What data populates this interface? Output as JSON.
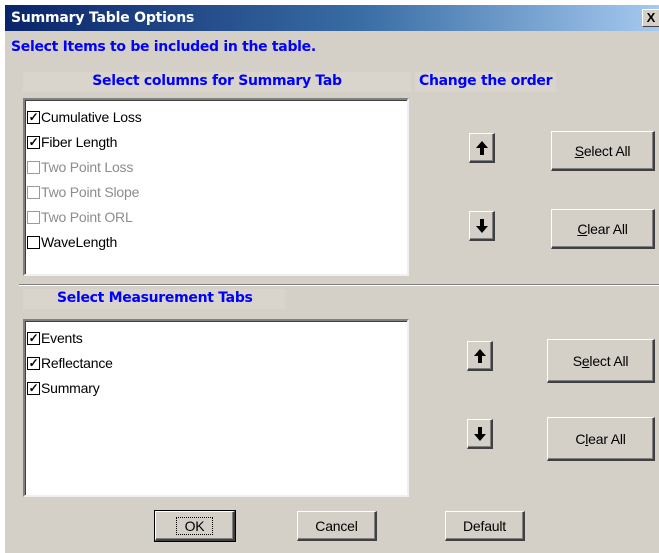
{
  "window": {
    "title": "Summary Table Options",
    "close_label": "X"
  },
  "header": {
    "instruction": "Select Items to be included in the table."
  },
  "columns_section": {
    "heading": "Select columns for Summary Tab",
    "order_heading": "Change the order",
    "items": [
      {
        "label": "Cumulative Loss",
        "checked": true,
        "enabled": true
      },
      {
        "label": "Fiber Length",
        "checked": true,
        "enabled": true
      },
      {
        "label": "Two Point Loss",
        "checked": false,
        "enabled": false
      },
      {
        "label": "Two Point Slope",
        "checked": false,
        "enabled": false
      },
      {
        "label": "Two Point ORL",
        "checked": false,
        "enabled": false
      },
      {
        "label": "WaveLength",
        "checked": false,
        "enabled": true
      }
    ],
    "select_all": {
      "mnemonic": "S",
      "rest": "elect All"
    },
    "clear_all": {
      "mnemonic": "C",
      "rest": "lear All"
    }
  },
  "measurement_section": {
    "heading": "Select Measurement Tabs",
    "items": [
      {
        "label": "Events",
        "checked": true,
        "enabled": true
      },
      {
        "label": "Reflectance",
        "checked": true,
        "enabled": true
      },
      {
        "label": "Summary",
        "checked": true,
        "enabled": true
      }
    ],
    "select_all": {
      "pre": "S",
      "mnemonic": "e",
      "rest": "lect All"
    },
    "clear_all": {
      "pre": "C",
      "mnemonic": "l",
      "rest": "ear All"
    }
  },
  "footer": {
    "ok": "OK",
    "cancel": "Cancel",
    "default": "Default"
  },
  "icons": {
    "up": "arrow-up-icon",
    "down": "arrow-down-icon",
    "check": "✓"
  }
}
